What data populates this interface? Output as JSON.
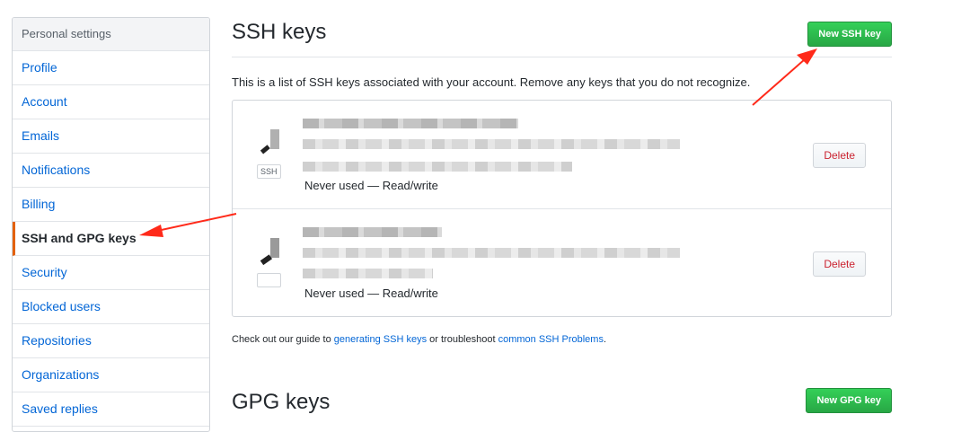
{
  "sidebar": {
    "header": "Personal settings",
    "items": [
      {
        "label": "Profile"
      },
      {
        "label": "Account"
      },
      {
        "label": "Emails"
      },
      {
        "label": "Notifications"
      },
      {
        "label": "Billing"
      },
      {
        "label": "SSH and GPG keys",
        "selected": true
      },
      {
        "label": "Security"
      },
      {
        "label": "Blocked users"
      },
      {
        "label": "Repositories"
      },
      {
        "label": "Organizations"
      },
      {
        "label": "Saved replies"
      }
    ]
  },
  "ssh": {
    "title": "SSH keys",
    "new_button": "New SSH key",
    "description": "This is a list of SSH keys associated with your account. Remove any keys that you do not recognize.",
    "keys": [
      {
        "badge": "SSH",
        "meta": "Never used — Read/write",
        "delete_label": "Delete"
      },
      {
        "badge": "",
        "meta": "Never used — Read/write",
        "delete_label": "Delete"
      }
    ],
    "guide": {
      "prefix": "Check out our guide to ",
      "link1": "generating SSH keys",
      "middle": " or troubleshoot ",
      "link2": "common SSH Problems",
      "suffix": "."
    }
  },
  "gpg": {
    "title": "GPG keys",
    "new_button": "New GPG key"
  },
  "colors": {
    "accent_link": "#0366d6",
    "primary_button": "#28a745",
    "danger": "#cb2431",
    "selected_border": "#e36209",
    "annotation_arrow": "#ff2a1a"
  }
}
